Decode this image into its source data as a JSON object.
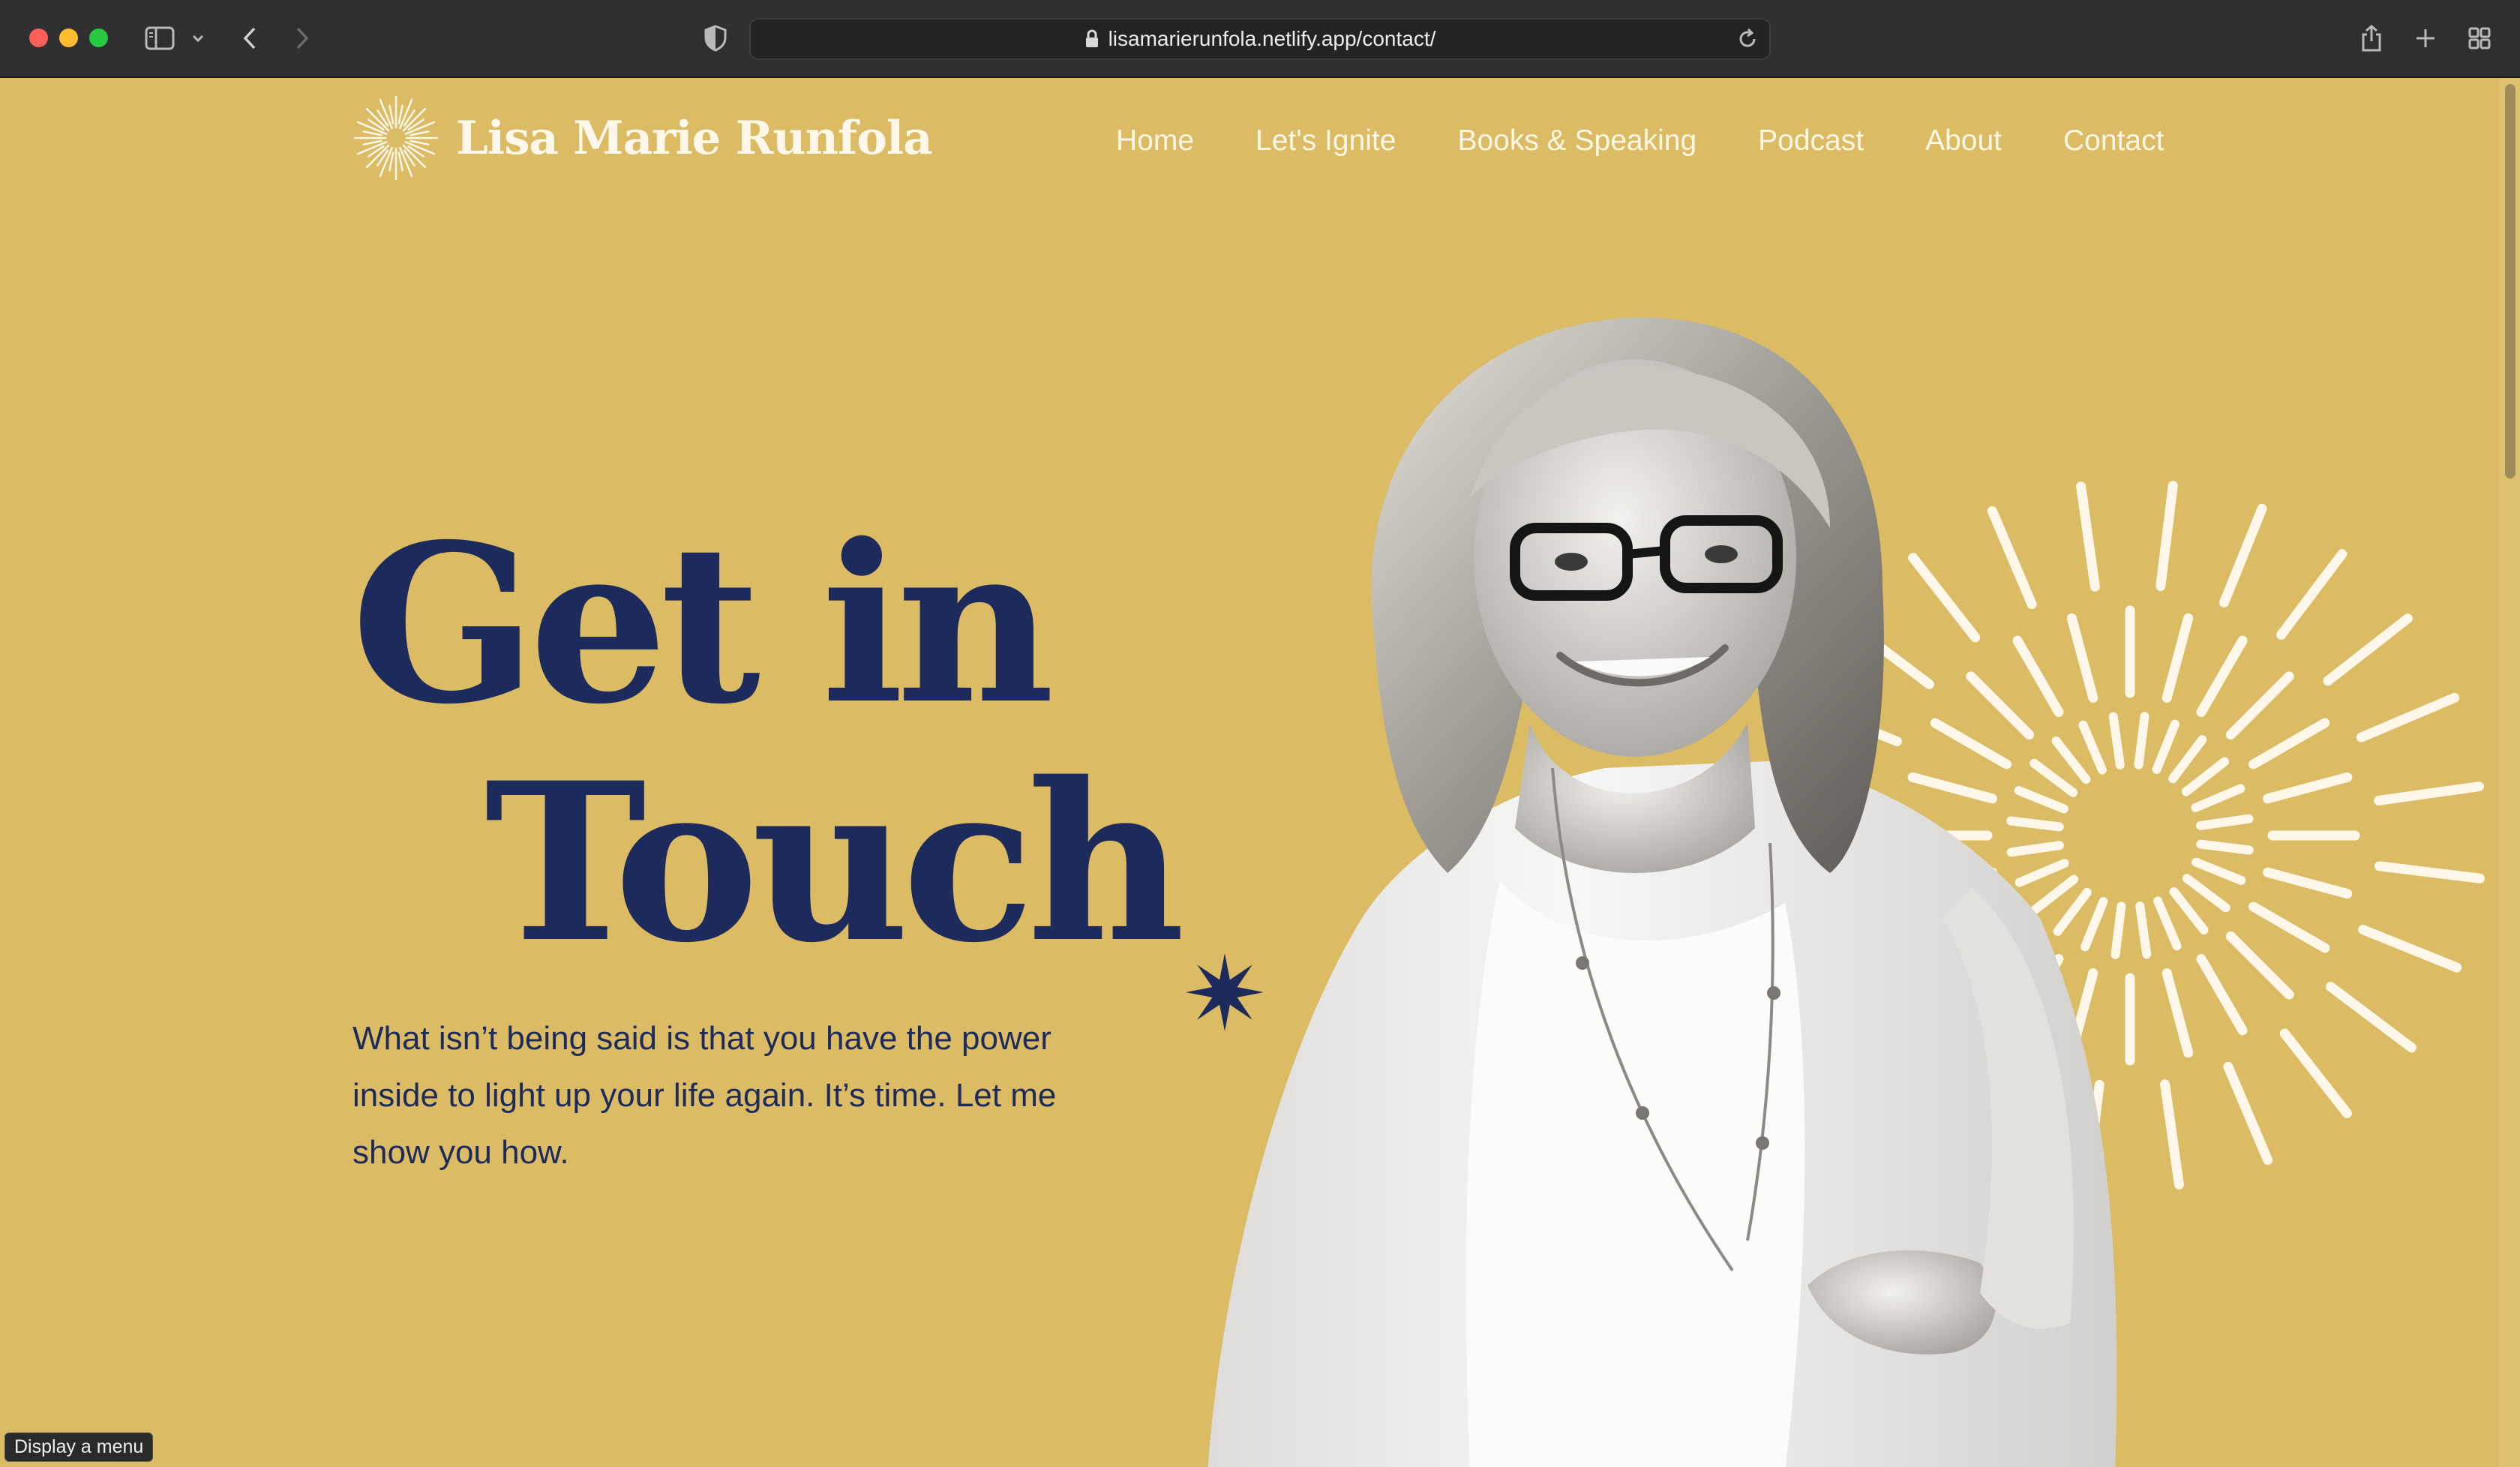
{
  "browser": {
    "url": "lisamarierunfola.netlify.app/contact/",
    "icons": [
      "sidebar-icon",
      "chevron-down-icon",
      "back-icon",
      "forward-icon",
      "shield-icon",
      "lock-icon",
      "reload-icon",
      "share-icon",
      "new-tab-icon",
      "tab-overview-icon"
    ]
  },
  "site": {
    "brand": "Lisa Marie Runfola",
    "nav": [
      {
        "label": "Home"
      },
      {
        "label": "Let's Ignite"
      },
      {
        "label": "Books & Speaking"
      },
      {
        "label": "Podcast"
      },
      {
        "label": "About"
      },
      {
        "label": "Contact"
      }
    ]
  },
  "hero": {
    "headline_line1": "Get in",
    "headline_line2": "Touch",
    "intro": "What isn’t being said is that you have the power inside to light up your life again. It’s time. Let me show you how."
  },
  "status": {
    "tooltip": "Display a menu"
  },
  "colors": {
    "page_background": "#dbbb64",
    "headline_navy": "#1d2a5c",
    "cream": "#fff8ea"
  }
}
